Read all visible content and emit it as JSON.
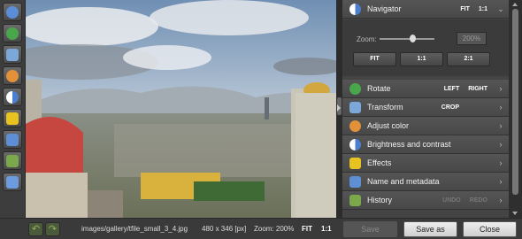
{
  "toolbar": {
    "tools": [
      {
        "icon": "zoom-icon",
        "color": "#5b8ed6"
      },
      {
        "icon": "rotate-icon",
        "color": "#4aa64a"
      },
      {
        "icon": "crop-icon",
        "color": "#7ca7d9"
      },
      {
        "icon": "palette-icon",
        "color": "#e3903a"
      },
      {
        "icon": "brightness-icon",
        "color": "#4d7fd1"
      },
      {
        "icon": "effects-icon",
        "color": "#e8c21e"
      },
      {
        "icon": "metadata-icon",
        "color": "#5e8fd4"
      },
      {
        "icon": "history-icon",
        "color": "#7aa84a"
      },
      {
        "icon": "gallery-icon",
        "color": "#6d9be0"
      }
    ]
  },
  "panel": {
    "navigator": {
      "label": "Navigator",
      "fit": "FIT",
      "one_to_one": "1:1",
      "zoom_label": "Zoom:",
      "zoom_value": "200%",
      "zoom_slider_fraction": 0.6,
      "buttons": [
        "FIT",
        "1:1",
        "2:1"
      ]
    },
    "rows": [
      {
        "label": "Rotate",
        "opts": [
          "LEFT",
          "RIGHT"
        ],
        "icon": "rotate-icon",
        "color": "#4aa64a"
      },
      {
        "label": "Transform",
        "opts": [
          "CROP"
        ],
        "icon": "transform-icon",
        "color": "#7ca7d9"
      },
      {
        "label": "Adjust color",
        "opts": [],
        "icon": "palette-icon",
        "color": "#e3903a"
      },
      {
        "label": "Brightness and contrast",
        "opts": [],
        "icon": "brightness-icon",
        "color": "#4d7fd1"
      },
      {
        "label": "Effects",
        "opts": [],
        "icon": "effects-icon",
        "color": "#e8c21e"
      },
      {
        "label": "Name and metadata",
        "opts": [],
        "icon": "metadata-icon",
        "color": "#5e8fd4"
      },
      {
        "label": "History",
        "opts": [
          "UNDO",
          "REDO"
        ],
        "icon": "history-icon",
        "color": "#7aa84a"
      }
    ]
  },
  "status": {
    "path": "images/gallery/tfile_small_3_4.jpg",
    "dims": "480 x 346 [px]",
    "zoom": "Zoom: 200%",
    "fit": "FIT",
    "one_to_one": "1:1",
    "save": "Save",
    "save_as": "Save as",
    "close": "Close"
  }
}
